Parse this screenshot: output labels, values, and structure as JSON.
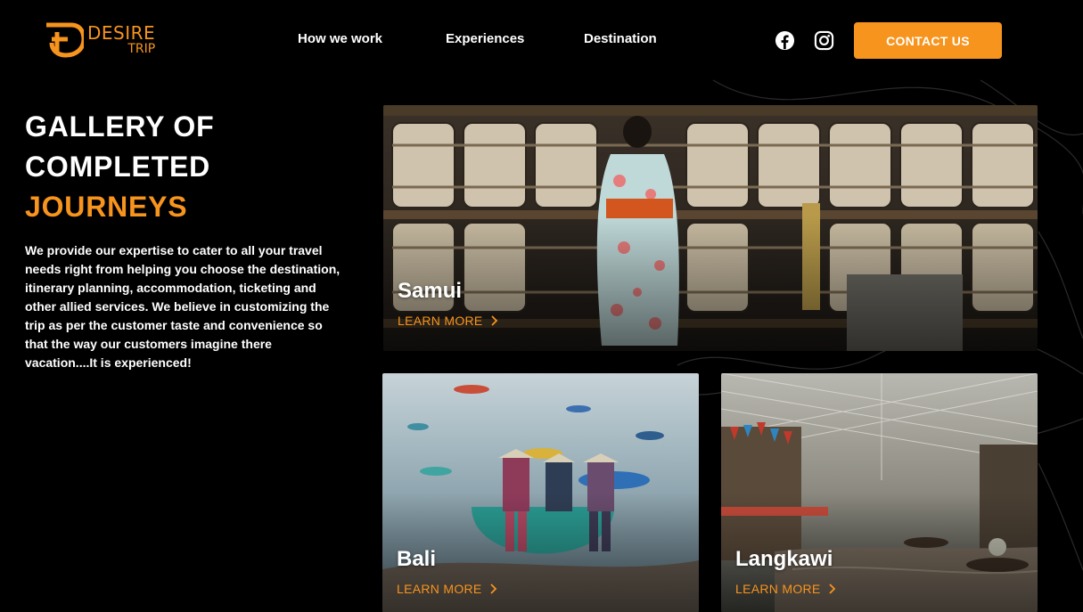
{
  "brand": {
    "name_top": "DESIRE",
    "name_bottom": "TRIP",
    "accent_color": "#f7941d"
  },
  "nav": {
    "items": [
      {
        "label": "How we work"
      },
      {
        "label": "Experiences"
      },
      {
        "label": "Destination"
      }
    ]
  },
  "social": {
    "icons": [
      "facebook-icon",
      "instagram-icon"
    ]
  },
  "cta": {
    "label": "CONTACT US"
  },
  "hero": {
    "line1": "GALLERY OF",
    "line2": "COMPLETED",
    "line3": "JOURNEYS",
    "description": "We provide our expertise to cater to all your travel needs right from helping you choose the destination, itinerary planning, accommodation, ticketing and other allied services. We believe in customizing the trip as per the customer taste and convenience so that the way our customers imagine there vacation....It is experienced!"
  },
  "cards": [
    {
      "title": "Samui",
      "link_label": "LEARN MORE"
    },
    {
      "title": "Bali",
      "link_label": "LEARN MORE"
    },
    {
      "title": "Langkawi",
      "link_label": "LEARN MORE"
    }
  ]
}
